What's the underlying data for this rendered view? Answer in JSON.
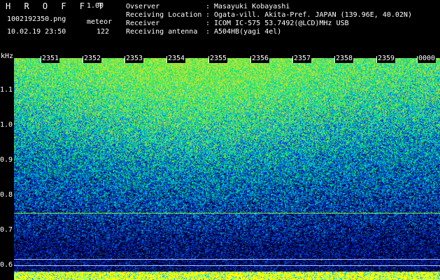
{
  "header": {
    "app_name": "H R O F F T",
    "version": "1.00",
    "filename": "1002192350.png",
    "mode": "meteor",
    "datetime": "10.02.19 23:50",
    "count": "122"
  },
  "info": [
    {
      "key": "Ovserver",
      "value": "Masayuki Kobayashi"
    },
    {
      "key": "Receiving Location",
      "value": "Ogata-vill. Akita-Pref. JAPAN (139.96E, 40.02N)"
    },
    {
      "key": "Receiver",
      "value": "ICOM IC-575 53.7492(@LCD)MHz USB"
    },
    {
      "key": "Receiving antenna",
      "value": "A504HB(yagi 4el)"
    }
  ],
  "axis": {
    "unit": "kHz",
    "freq_ticks": [
      "1.1",
      "1.0",
      "0.9",
      "0.8",
      "0.7",
      "0.6"
    ],
    "time_ticks": [
      "2351",
      "2352",
      "2353",
      "2354",
      "2355",
      "2356",
      "2357",
      "2358",
      "2359",
      "0000"
    ]
  },
  "colors": {
    "background": "#000000",
    "meteor_line": "#7fff3f",
    "ref_line": "#c0d0ff",
    "bottom_bar": "#ffff00"
  }
}
